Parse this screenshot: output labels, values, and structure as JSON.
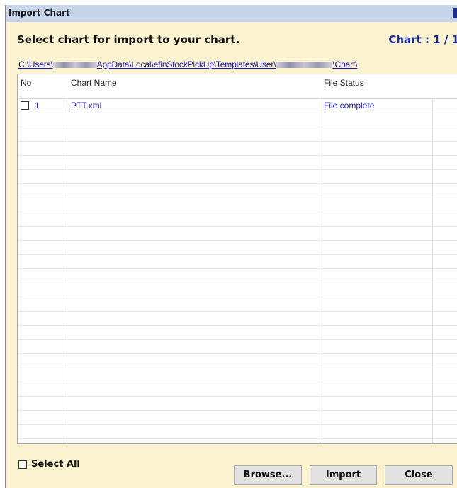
{
  "window": {
    "title": "Import Chart"
  },
  "header": {
    "heading": "Select chart for import to your chart.",
    "counter": "Chart : 1 / 1"
  },
  "path": {
    "p1": "C:\\Users\\",
    "p2": "AppData\\Local\\efinStockPickUp\\Templates\\User\\",
    "p3": "\\Chart\\"
  },
  "table": {
    "columns": [
      "No",
      "Chart Name",
      "File Status"
    ],
    "rows": [
      {
        "no": "1",
        "name": "PTT.xml",
        "status": "File complete",
        "checked": false
      }
    ]
  },
  "footer": {
    "select_all_label": "Select All",
    "browse_label": "Browse...",
    "import_label": "Import",
    "close_label": "Close"
  }
}
